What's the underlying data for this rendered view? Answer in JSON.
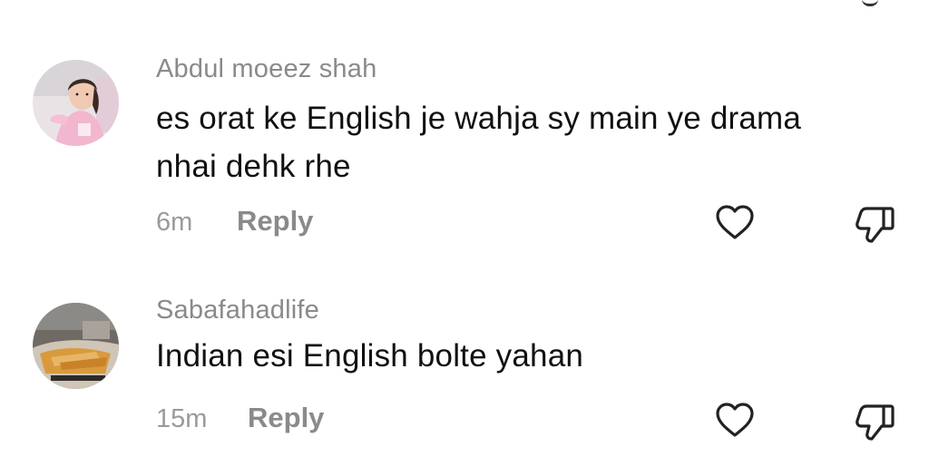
{
  "comments": [
    {
      "username": "Abdul moeez shah",
      "text": "es orat ke English je wahja sy main ye drama nhai dehk rhe",
      "time": "6m",
      "reply_label": "Reply",
      "like_icon": "heart-outline-icon",
      "dislike_icon": "thumbs-down-outline-icon"
    },
    {
      "username": "Sabafahadlife",
      "text": "Indian esi English bolte yahan",
      "time": "15m",
      "reply_label": "Reply",
      "like_icon": "heart-outline-icon",
      "dislike_icon": "thumbs-down-outline-icon"
    }
  ],
  "colors": {
    "username": "#8a8a8a",
    "comment_text": "#111111",
    "meta": "#9a9a9a",
    "icon_stroke": "#222222"
  }
}
